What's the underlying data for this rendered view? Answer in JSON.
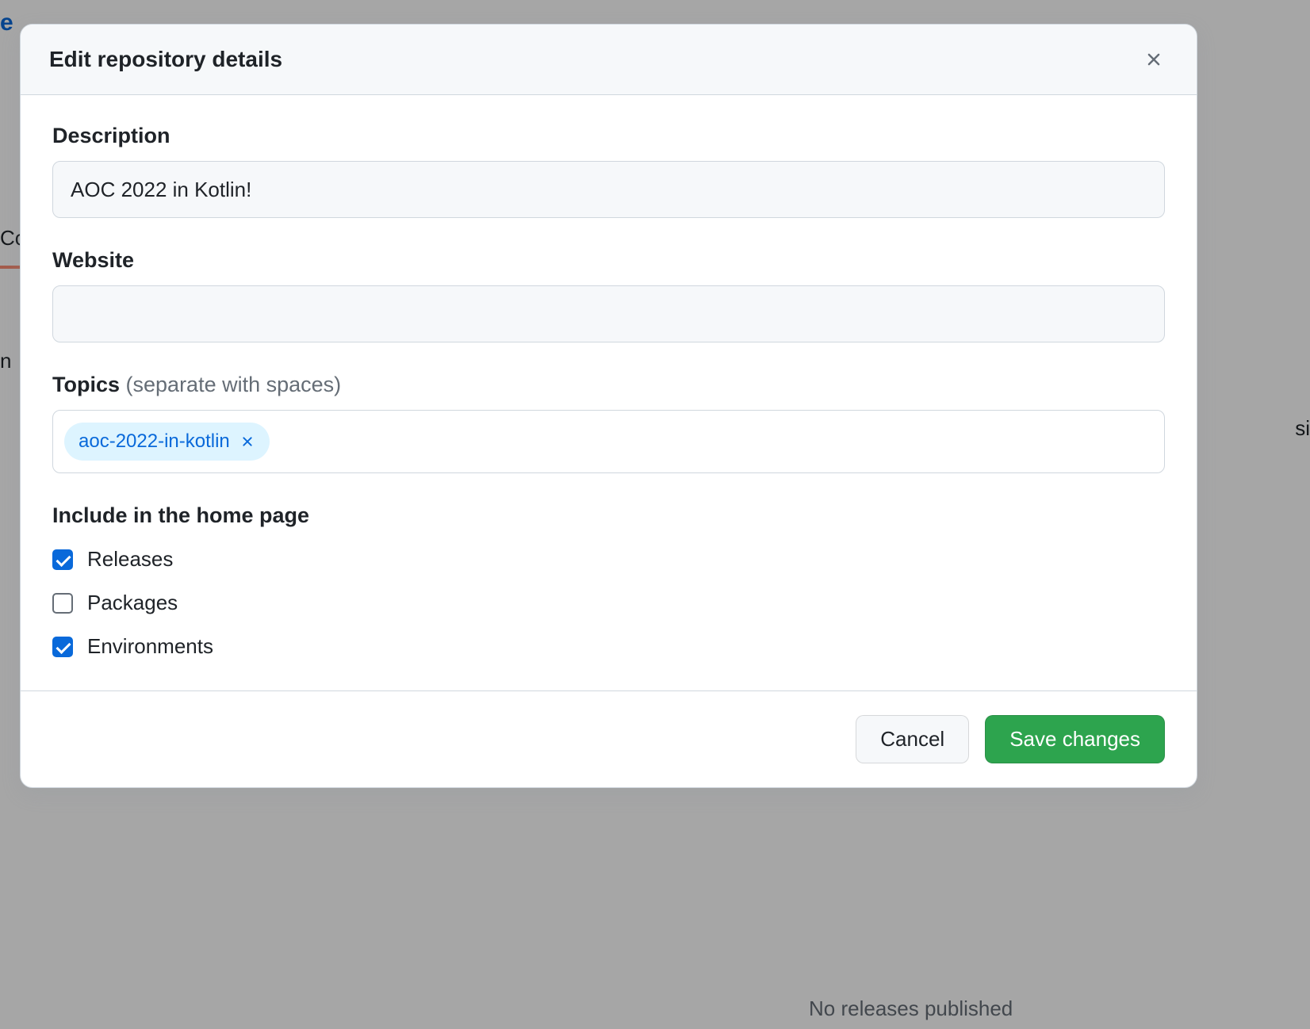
{
  "modal": {
    "title": "Edit repository details",
    "description": {
      "label": "Description",
      "value": "AOC 2022 in Kotlin!"
    },
    "website": {
      "label": "Website",
      "value": ""
    },
    "topics": {
      "label": "Topics",
      "hint": "(separate with spaces)",
      "chips": [
        {
          "text": "aoc-2022-in-kotlin"
        }
      ]
    },
    "include": {
      "heading": "Include in the home page",
      "options": [
        {
          "label": "Releases",
          "checked": true
        },
        {
          "label": "Packages",
          "checked": false
        },
        {
          "label": "Environments",
          "checked": true
        }
      ]
    },
    "footer": {
      "cancel": "Cancel",
      "save": "Save changes"
    }
  },
  "background": {
    "link_fragment": "e",
    "tab_fragment_left": "Co",
    "row_fragment_left": "n",
    "right_fragment": "si",
    "below_text": "No releases published"
  }
}
